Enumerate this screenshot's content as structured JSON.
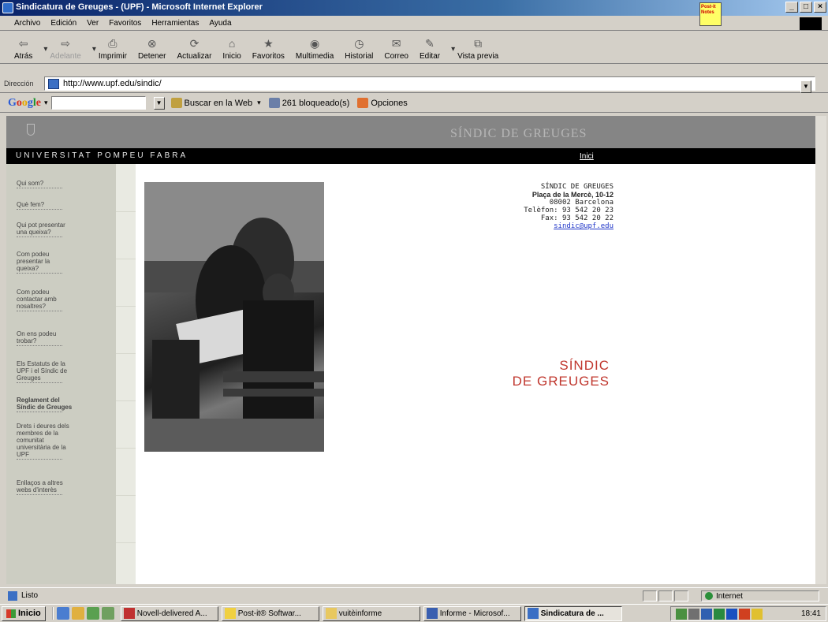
{
  "window": {
    "title": "Sindicatura de Greuges - (UPF) - Microsoft Internet Explorer",
    "postit_label": "Post-it Notes"
  },
  "menu": [
    "Archivo",
    "Edición",
    "Ver",
    "Favoritos",
    "Herramientas",
    "Ayuda"
  ],
  "toolbar": {
    "back": "Atrás",
    "forward": "Adelante",
    "print": "Imprimir",
    "stop": "Detener",
    "refresh": "Actualizar",
    "home": "Inicio",
    "favorites": "Favoritos",
    "multimedia": "Multimedia",
    "history": "Historial",
    "mail": "Correo",
    "edit": "Editar",
    "preview": "Vista previa"
  },
  "address": {
    "label": "Dirección",
    "url": "http://www.upf.edu/sindic/"
  },
  "google_bar": {
    "logo": "Google",
    "search_value": "",
    "search_web": "Buscar en la Web",
    "blocked": "261 bloqueado(s)",
    "options": "Opciones"
  },
  "site": {
    "brand": "SÍNDIC DE GREUGES",
    "university": "UNIVERSITAT POMPEU FABRA",
    "home_link": "Inici",
    "nav": [
      "Qui som?",
      "Què fem?",
      "Qui pot presentar una queixa?",
      "Com podeu presentar la queixa?",
      "Com podeu contactar amb nosaltres?",
      "On ens podeu trobar?",
      "Els Estatuts de la UPF i el Síndic de Greuges",
      "Reglament del Síndic de Greuges",
      "Drets i deures dels membres de la comunitat universitària de la UPF",
      "Enllaços a altres webs d'interès"
    ],
    "contact": {
      "name": "SÍNDIC DE GREUGES",
      "street": "Plaça de la Mercè, 10-12",
      "city": "08002 Barcelona",
      "phone": "Telèfon: 93 542 20 23",
      "fax": "Fax: 93 542 20 22",
      "email": "sindic@upf.edu"
    },
    "title_line1": "SÍNDIC",
    "title_line2": "DE GREUGES"
  },
  "status": {
    "text": "Listo",
    "zone": "Internet"
  },
  "taskbar": {
    "start": "Inicio",
    "tasks": [
      "Novell-delivered A...",
      "Post-it® Softwar...",
      "vuitèinforme",
      "Informe - Microsof...",
      "Sindicatura de ..."
    ],
    "clock": "18:41"
  },
  "colors": {
    "accent_red": "#c0372e",
    "sidebar_bg": "#cccdc2",
    "header_gray": "#858585"
  }
}
